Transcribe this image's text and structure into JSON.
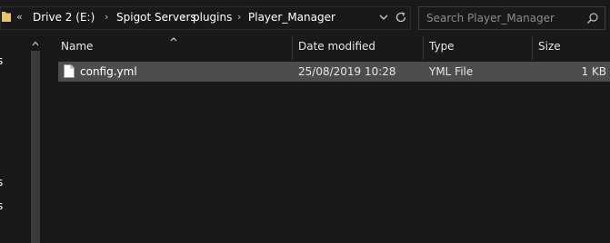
{
  "address_bar": {
    "overflow_chevron": "«",
    "breadcrumbs": [
      "Drive 2 (E:)",
      "Spigot Servers",
      "plugins",
      "Player_Manager"
    ],
    "separator": "›"
  },
  "search": {
    "placeholder": "Search Player_Manager"
  },
  "nav_pane": {
    "cut_labels": [
      "s",
      "s",
      "s"
    ]
  },
  "columns": {
    "name": "Name",
    "date_modified": "Date modified",
    "type": "Type",
    "size": "Size"
  },
  "files": [
    {
      "name": "config.yml",
      "date_modified": "25/08/2019 10:28",
      "type": "YML File",
      "size": "1 KB",
      "selected": true
    }
  ],
  "colors": {
    "background": "#191919",
    "selected_row": "#4d4d4d",
    "folder_icon": "#e8c56a"
  }
}
